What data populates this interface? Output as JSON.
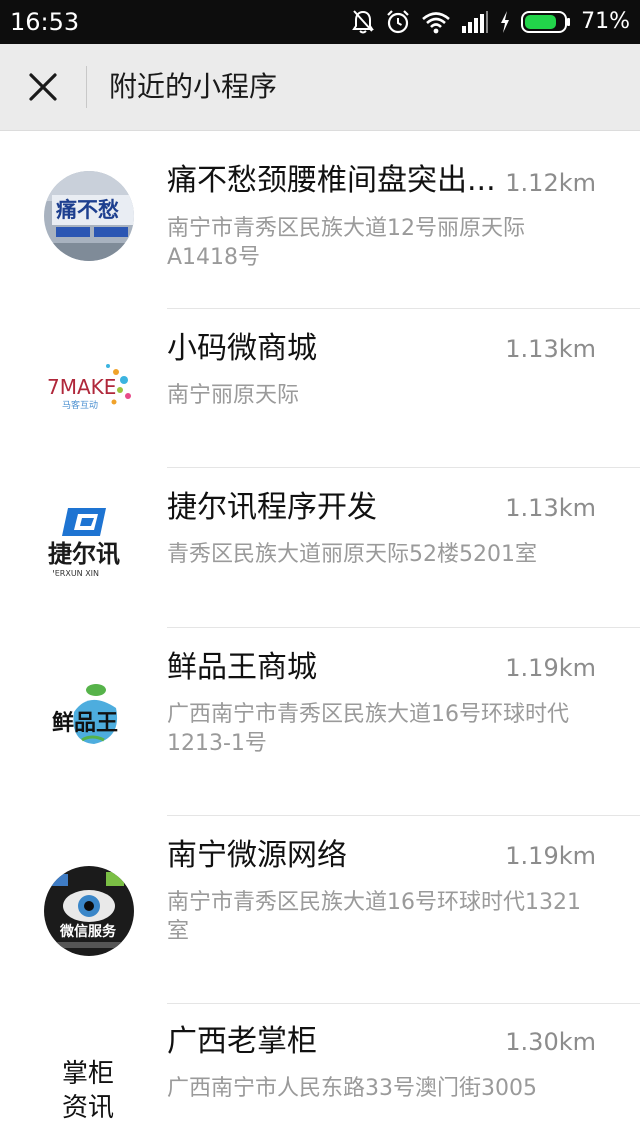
{
  "status_bar": {
    "time": "16:53",
    "battery": "71%",
    "icons": [
      "mute-bell-icon",
      "alarm-icon",
      "wifi-icon",
      "signal-icon",
      "charging-icon",
      "battery-icon"
    ]
  },
  "header": {
    "title": "附近的小程序",
    "close_icon": "close-icon"
  },
  "items": [
    {
      "name": "痛不愁颈腰椎间盘突出...",
      "distance": "1.12km",
      "address": "南宁市青秀区民族大道12号丽原天际A1418号",
      "logo_text": "痛不愁"
    },
    {
      "name": "小码微商城",
      "distance": "1.13km",
      "address": "南宁丽原天际",
      "logo_text": "7MAKE",
      "logo_sub": "马客互动"
    },
    {
      "name": "捷尔讯程序开发",
      "distance": "1.13km",
      "address": "青秀区民族大道丽原天际52楼5201室",
      "logo_text": "捷尔讯",
      "logo_sub": "JIERXUN XIN"
    },
    {
      "name": "鲜品王商城",
      "distance": "1.19km",
      "address": "广西南宁市青秀区民族大道16号环球时代1213-1号",
      "logo_text": "鲜品王"
    },
    {
      "name": "南宁微源网络",
      "distance": "1.19km",
      "address": "南宁市青秀区民族大道16号环球时代1321室",
      "logo_text": "微信服务"
    },
    {
      "name": "广西老掌柜",
      "distance": "1.30km",
      "address": "广西南宁市人民东路33号澳门街3005",
      "logo_line1": "掌柜",
      "logo_line2": "资讯"
    }
  ],
  "colors": {
    "status_bar_bg": "#0d0d0d",
    "header_bg": "#ebebeb",
    "battery_green": "#22d44a",
    "distance_text": "#8c8c8c"
  }
}
